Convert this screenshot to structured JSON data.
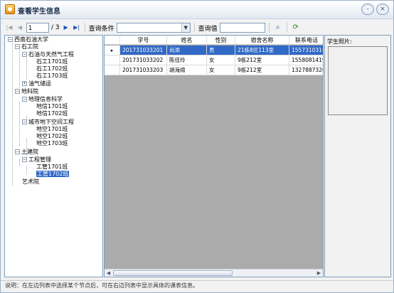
{
  "window": {
    "title": "查看学生信息"
  },
  "toolbar": {
    "page_input": "1",
    "page_total": "/ 3",
    "query_condition_label": "查询条件",
    "query_condition_value": "",
    "query_value_label": "查询值",
    "query_value": ""
  },
  "tree": {
    "root": "西南石油大学",
    "n1": "石工院",
    "n1a": "石油与天然气工程",
    "n1a1": "石工1701班",
    "n1a2": "石工1702班",
    "n1a3": "石工1703班",
    "n1b": "油气储运",
    "n2": "地科院",
    "n2a": "地理信息科学",
    "n2a1": "地信1701班",
    "n2a2": "地信1702班",
    "n2b": "城市地下空间工程",
    "n2b1": "地空1701班",
    "n2b2": "地空1702班",
    "n2b3": "地空1703班",
    "n3": "土建院",
    "n3a": "工程管理",
    "n3a1": "工管1701班",
    "n3a2": "工管1702班",
    "n4": "艺术院"
  },
  "grid": {
    "columns": [
      "学号",
      "姓名",
      "性别",
      "宿舍名称",
      "联系电话"
    ],
    "rows": [
      [
        "201731033201",
        "尚添",
        "男",
        "21栋8区113室",
        "15573103160"
      ],
      [
        "201731033202",
        "陈佳玲",
        "女",
        "9栋212室",
        "15580814199"
      ],
      [
        "201731033203",
        "胡海绵",
        "女",
        "9栋212室",
        "13278873203"
      ]
    ],
    "current_row_marker": "▸"
  },
  "photo": {
    "label": "学生照片:"
  },
  "status": {
    "text": "说明：在左边列表中选择某个节点后，可在右边列表中显示具体的课表信息。"
  },
  "icons": {
    "first": "first-page-icon",
    "prev": "prev-page-icon",
    "next": "next-page-icon",
    "last": "last-page-icon",
    "search": "search-icon",
    "refresh": "refresh-icon",
    "dropdown": "chevron-down-icon"
  },
  "colors": {
    "selection": "#3169c6",
    "grid_bg": "#ababab",
    "border": "#7f9db9"
  }
}
